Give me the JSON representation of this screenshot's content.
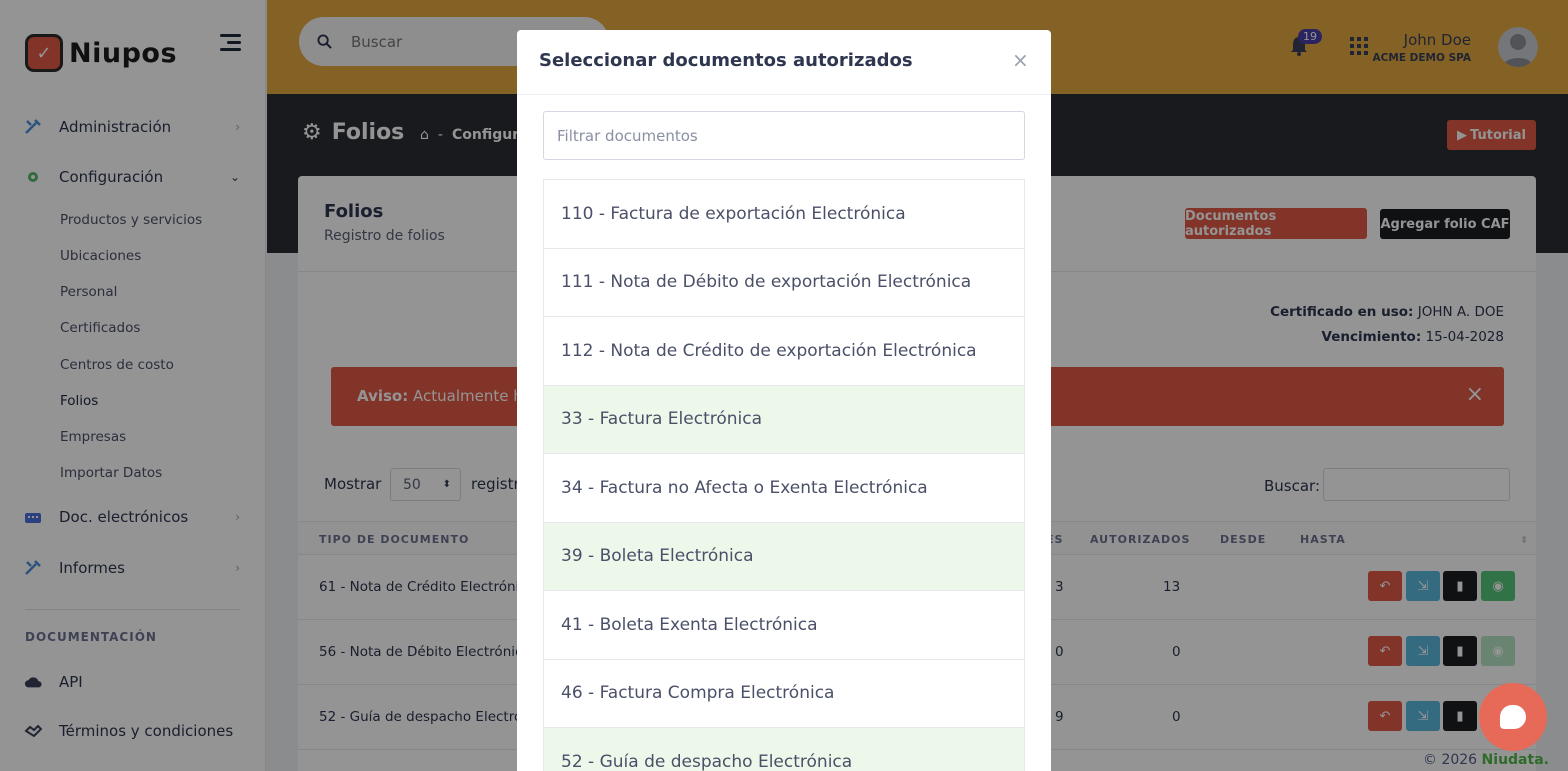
{
  "brand": {
    "name": "Niupos"
  },
  "sidebar": {
    "items": [
      {
        "label": "Administración",
        "icon": "tools-icon"
      },
      {
        "label": "Configuración",
        "icon": "gear-icon"
      },
      {
        "label": "Doc. electrónicos",
        "icon": "keyboard-icon"
      },
      {
        "label": "Informes",
        "icon": "tools-icon"
      }
    ],
    "subitems": [
      "Productos y servicios",
      "Ubicaciones",
      "Personal",
      "Certificados",
      "Centros de costo",
      "Folios",
      "Empresas",
      "Importar Datos"
    ],
    "section": "DOCUMENTACIÓN",
    "doc_items": [
      {
        "label": "API",
        "icon": "cloud-icon"
      },
      {
        "label": "Términos y condiciones",
        "icon": "handshake-icon"
      }
    ]
  },
  "topbar": {
    "search_placeholder": "Buscar",
    "notifications": "19",
    "user_name": "John Doe",
    "user_org": "ACME DEMO SPA"
  },
  "header": {
    "title": "Folios",
    "breadcrumb": "Configur",
    "tutorial": "Tutorial"
  },
  "card": {
    "title": "Folios",
    "subtitle": "Registro de folios",
    "btn_docs": "Documentos autorizados",
    "btn_add": "Agregar folio CAF",
    "cert_label": "Certificado en uso:",
    "cert_value": "JOHN A. DOE",
    "venc_label": "Vencimiento:",
    "venc_value": "15-04-2028",
    "alert_bold": "Aviso:",
    "alert_text": "Actualmente hay",
    "show_label": "Mostrar",
    "show_value": "50",
    "regs_label": "registr",
    "search_label": "Buscar:"
  },
  "table": {
    "headers": [
      "TIPO DE DOCUMENTO",
      "ES",
      "AUTORIZADOS",
      "DESDE",
      "HASTA"
    ],
    "rows": [
      {
        "tipo": "61 - Nota de Crédito Electrónica",
        "es": "3",
        "autorizados": "13"
      },
      {
        "tipo": "56 - Nota de Débito Electrónica",
        "es": "0",
        "autorizados": "0"
      },
      {
        "tipo": "52 - Guía de despacho Electrón",
        "es": "9",
        "autorizados": "0"
      }
    ]
  },
  "modal": {
    "title": "Seleccionar documentos autorizados",
    "close": "×",
    "filter_placeholder": "Filtrar documentos",
    "items": [
      {
        "label": "110 - Factura de exportación Electrónica",
        "selected": false
      },
      {
        "label": "111 - Nota de Débito de exportación Electrónica",
        "selected": false
      },
      {
        "label": "112 - Nota de Crédito de exportación Electrónica",
        "selected": false
      },
      {
        "label": "33 - Factura Electrónica",
        "selected": true
      },
      {
        "label": "34 - Factura no Afecta o Exenta Electrónica",
        "selected": false
      },
      {
        "label": "39 - Boleta Electrónica",
        "selected": true
      },
      {
        "label": "41 - Boleta Exenta Electrónica",
        "selected": false
      },
      {
        "label": "46 - Factura Compra Electrónica",
        "selected": false
      },
      {
        "label": "52 - Guía de despacho Electrónica",
        "selected": true
      }
    ]
  },
  "footer": {
    "copyright": "© 2026",
    "brand": "Niudata."
  },
  "colors": {
    "accent": "#e4a73f",
    "danger": "#e05a47",
    "dark": "#2a2d33",
    "selected": "#eef8ea"
  }
}
